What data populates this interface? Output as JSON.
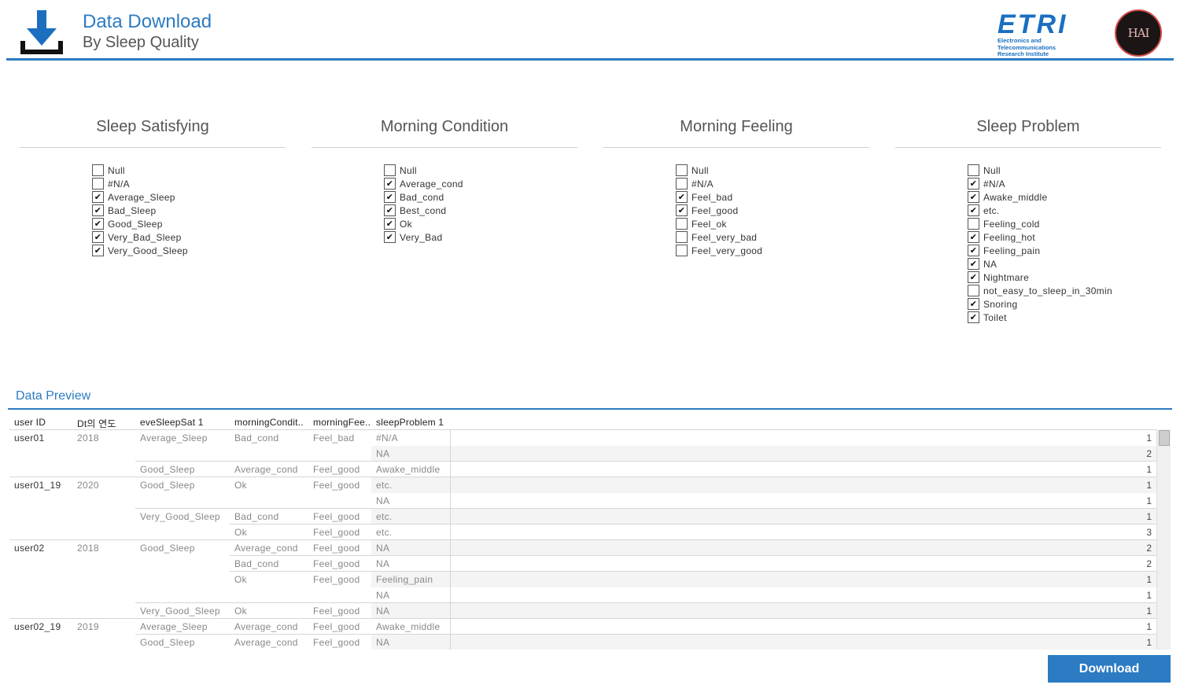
{
  "header": {
    "title": "Data Download",
    "subtitle": "By Sleep Quality",
    "etri_wordmark": "ETRI",
    "etri_subtitle_line1": "Electronics and Telecommunications",
    "etri_subtitle_line2": "Research Institute",
    "hai_logo_text": "HAI"
  },
  "filters": [
    {
      "title": "Sleep Satisfying",
      "options": [
        {
          "label": "Null",
          "checked": false
        },
        {
          "label": "#N/A",
          "checked": false
        },
        {
          "label": "Average_Sleep",
          "checked": true
        },
        {
          "label": "Bad_Sleep",
          "checked": true
        },
        {
          "label": "Good_Sleep",
          "checked": true
        },
        {
          "label": "Very_Bad_Sleep",
          "checked": true
        },
        {
          "label": "Very_Good_Sleep",
          "checked": true
        }
      ]
    },
    {
      "title": "Morning Condition",
      "options": [
        {
          "label": "Null",
          "checked": false
        },
        {
          "label": "Average_cond",
          "checked": true
        },
        {
          "label": "Bad_cond",
          "checked": true
        },
        {
          "label": "Best_cond",
          "checked": true
        },
        {
          "label": "Ok",
          "checked": true
        },
        {
          "label": "Very_Bad",
          "checked": true
        }
      ]
    },
    {
      "title": "Morning Feeling",
      "options": [
        {
          "label": "Null",
          "checked": false
        },
        {
          "label": "#N/A",
          "checked": false
        },
        {
          "label": "Feel_bad",
          "checked": true
        },
        {
          "label": "Feel_good",
          "checked": true
        },
        {
          "label": "Feel_ok",
          "checked": false
        },
        {
          "label": "Feel_very_bad",
          "checked": false
        },
        {
          "label": "Feel_very_good",
          "checked": false
        }
      ]
    },
    {
      "title": "Sleep Problem",
      "options": [
        {
          "label": "Null",
          "checked": false
        },
        {
          "label": "#N/A",
          "checked": true
        },
        {
          "label": "Awake_middle",
          "checked": true
        },
        {
          "label": "etc.",
          "checked": true
        },
        {
          "label": "Feeling_cold",
          "checked": false
        },
        {
          "label": "Feeling_hot",
          "checked": true
        },
        {
          "label": "Feeling_pain",
          "checked": true
        },
        {
          "label": "NA",
          "checked": true
        },
        {
          "label": "Nightmare",
          "checked": true
        },
        {
          "label": "not_easy_to_sleep_in_30min",
          "checked": false
        },
        {
          "label": "Snoring",
          "checked": true
        },
        {
          "label": "Toilet",
          "checked": true
        }
      ]
    }
  ],
  "check_glyph": "✔",
  "preview": {
    "title": "Data Preview",
    "columns": [
      "user ID",
      "Dt의 연도",
      "eveSleepSat 1",
      "morningCondit..",
      "morningFee..",
      "sleepProblem 1"
    ],
    "rows": [
      {
        "user": "user01",
        "year": "2018",
        "sat": "Average_Sleep",
        "cond": "Bad_cond",
        "feel": "Feel_bad",
        "problem": "#N/A",
        "count": "1"
      },
      {
        "user": "",
        "year": "",
        "sat": "",
        "cond": "",
        "feel": "",
        "problem": "NA",
        "count": "2"
      },
      {
        "user": "",
        "year": "",
        "sat": "Good_Sleep",
        "cond": "Average_cond",
        "feel": "Feel_good",
        "problem": "Awake_middle",
        "count": "1"
      },
      {
        "user": "user01_19",
        "year": "2020",
        "sat": "Good_Sleep",
        "cond": "Ok",
        "feel": "Feel_good",
        "problem": "etc.",
        "count": "1"
      },
      {
        "user": "",
        "year": "",
        "sat": "",
        "cond": "",
        "feel": "",
        "problem": "NA",
        "count": "1"
      },
      {
        "user": "",
        "year": "",
        "sat": "Very_Good_Sleep",
        "cond": "Bad_cond",
        "feel": "Feel_good",
        "problem": "etc.",
        "count": "1"
      },
      {
        "user": "",
        "year": "",
        "sat": "",
        "cond": "Ok",
        "feel": "Feel_good",
        "problem": "etc.",
        "count": "3"
      },
      {
        "user": "user02",
        "year": "2018",
        "sat": "Good_Sleep",
        "cond": "Average_cond",
        "feel": "Feel_good",
        "problem": "NA",
        "count": "2"
      },
      {
        "user": "",
        "year": "",
        "sat": "",
        "cond": "Bad_cond",
        "feel": "Feel_good",
        "problem": "NA",
        "count": "2"
      },
      {
        "user": "",
        "year": "",
        "sat": "",
        "cond": "Ok",
        "feel": "Feel_good",
        "problem": "Feeling_pain",
        "count": "1"
      },
      {
        "user": "",
        "year": "",
        "sat": "",
        "cond": "",
        "feel": "",
        "problem": "NA",
        "count": "1"
      },
      {
        "user": "",
        "year": "",
        "sat": "Very_Good_Sleep",
        "cond": "Ok",
        "feel": "Feel_good",
        "problem": "NA",
        "count": "1"
      },
      {
        "user": "user02_19",
        "year": "2019",
        "sat": "Average_Sleep",
        "cond": "Average_cond",
        "feel": "Feel_good",
        "problem": "Awake_middle",
        "count": "1"
      },
      {
        "user": "",
        "year": "",
        "sat": "Good_Sleep",
        "cond": "Average_cond",
        "feel": "Feel_good",
        "problem": "NA",
        "count": "1"
      }
    ]
  },
  "download_label": "Download",
  "colors": {
    "accent": "#2c7bc3",
    "band": "#f4f4f4"
  }
}
